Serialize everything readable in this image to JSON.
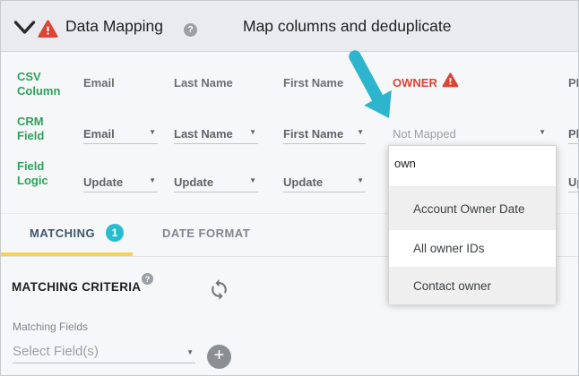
{
  "header": {
    "title": "Data Mapping",
    "subtitle": "Map columns and deduplicate",
    "help_glyph": "?"
  },
  "mapping": {
    "row_labels": {
      "csv": "CSV Column",
      "crm": "CRM Field",
      "logic": "Field Logic"
    },
    "columns": [
      {
        "csv": "Email",
        "crm": "Email",
        "logic": "Update"
      },
      {
        "csv": "Last Name",
        "crm": "Last Name",
        "logic": "Update"
      },
      {
        "csv": "First Name",
        "crm": "First Name",
        "logic": "Update"
      },
      {
        "csv": "OWNER",
        "crm": "Not Mapped",
        "logic": ""
      },
      {
        "csv": "PH",
        "crm": "Ph",
        "logic": "Up"
      }
    ]
  },
  "owner_dropdown": {
    "search_value": "own",
    "options": [
      "Account Owner Date",
      "All owner IDs",
      "Contact owner"
    ]
  },
  "tabs": {
    "matching": "MATCHING",
    "matching_badge": "1",
    "date_format": "DATE FORMAT"
  },
  "matching_section": {
    "title": "MATCHING CRITERIA",
    "help_glyph": "?",
    "fields_label": "Matching Fields",
    "select_value": "Select Field(s)",
    "add_glyph": "+"
  },
  "icons": {
    "dropdown_arrow": "▼"
  },
  "colors": {
    "accent_teal": "#2CB5CC",
    "badge_teal": "#27BCCE",
    "error_red": "#DB4437",
    "label_green": "#2BA25E",
    "tab_underline_yellow": "#F5D34A",
    "header_bg": "#E9EBEE"
  }
}
